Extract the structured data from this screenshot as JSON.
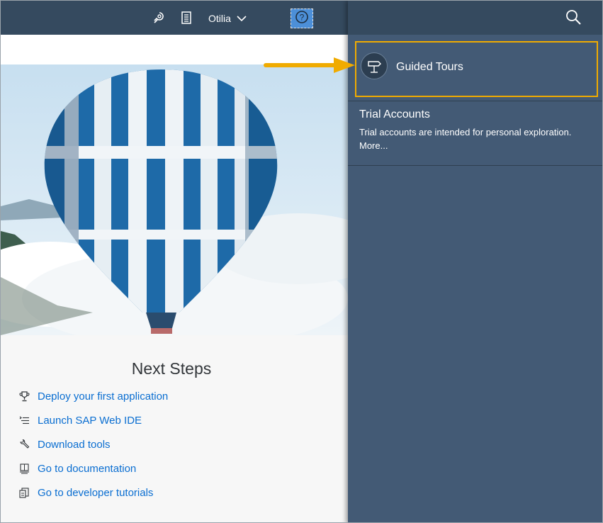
{
  "shellbar": {
    "user_name": "Otilia",
    "icons": [
      "notifications-icon",
      "notes-icon",
      "chevron-down-icon",
      "help-icon"
    ]
  },
  "help_panel": {
    "search_icon": "search-icon",
    "guided_tours": {
      "label": "Guided Tours",
      "icon": "signpost-icon"
    },
    "trial": {
      "title": "Trial Accounts",
      "description": "Trial accounts are intended for personal exploration.",
      "more_link": "More..."
    }
  },
  "next_steps": {
    "title": "Next Steps",
    "items": [
      {
        "label": "Deploy your first application",
        "icon": "trophy-icon"
      },
      {
        "label": "Launch SAP Web IDE",
        "icon": "code-list-icon"
      },
      {
        "label": "Download tools",
        "icon": "wrench-icon"
      },
      {
        "label": "Go to documentation",
        "icon": "book-icon"
      },
      {
        "label": "Go to developer tutorials",
        "icon": "tutorial-icon"
      }
    ]
  },
  "colors": {
    "shell": "#354a5f",
    "panel": "#435a75",
    "link": "#0a6ed1",
    "highlight": "#f0ab00",
    "help_active": "#4c8fd8"
  }
}
